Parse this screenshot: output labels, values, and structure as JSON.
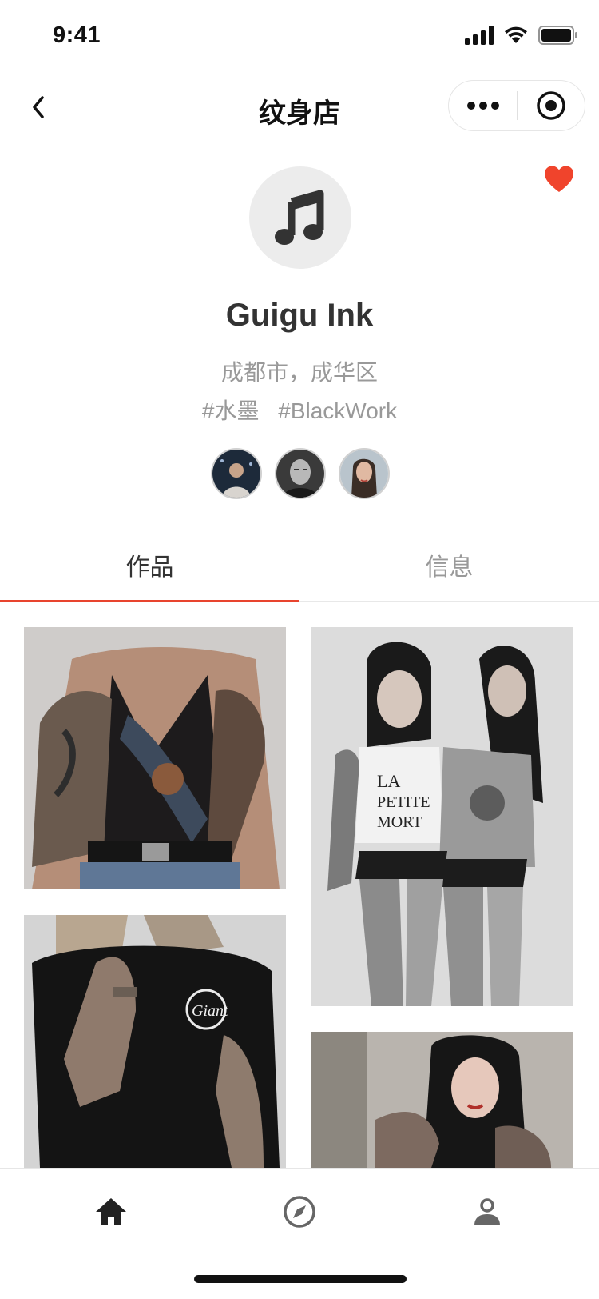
{
  "status_bar": {
    "time": "9:41"
  },
  "nav": {
    "title": "纹身店"
  },
  "shop": {
    "name": "Guigu Ink",
    "location": "成都市，成华区",
    "tags": [
      "#水墨",
      "#BlackWork"
    ],
    "is_favorited": true,
    "avatar_icon": "music-note-icon"
  },
  "artists": [
    {
      "icon": "artist-avatar-1"
    },
    {
      "icon": "artist-avatar-2"
    },
    {
      "icon": "artist-avatar-3"
    }
  ],
  "tabs": [
    {
      "label": "作品",
      "active": true
    },
    {
      "label": "信息",
      "active": false
    }
  ],
  "gallery": [
    {
      "icon": "tattoo-photo-1"
    },
    {
      "icon": "tattoo-photo-2"
    },
    {
      "icon": "tattoo-photo-3"
    },
    {
      "icon": "tattoo-photo-4"
    }
  ],
  "tabbar": [
    {
      "icon": "home-icon",
      "active": true
    },
    {
      "icon": "compass-icon",
      "active": false
    },
    {
      "icon": "user-icon",
      "active": false
    }
  ],
  "colors": {
    "accent": "#e8442e",
    "heart": "#f0442c",
    "text": "#333333",
    "muted": "#999999"
  }
}
